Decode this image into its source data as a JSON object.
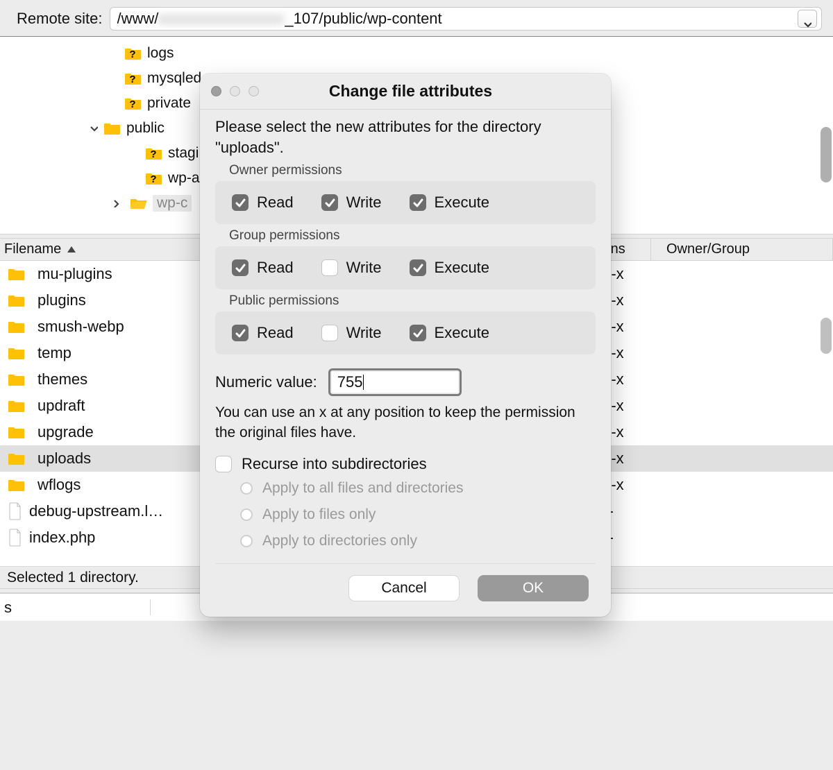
{
  "addr": {
    "label": "Remote site:",
    "prefix": "/www/",
    "suffix": "_107/public/wp-content"
  },
  "tree": {
    "items": [
      {
        "name": "logs"
      },
      {
        "name": "mysqled"
      },
      {
        "name": "private"
      },
      {
        "name": "public"
      },
      {
        "name": "stagi"
      },
      {
        "name": "wp-a"
      },
      {
        "name": "wp-c"
      }
    ]
  },
  "list_header": {
    "filename": "Filename",
    "permissions_partial": "ions",
    "owner_group": "Owner/Group"
  },
  "files": [
    {
      "name": "mu-plugins",
      "type": "folder",
      "perm": "xr-x"
    },
    {
      "name": "plugins",
      "type": "folder",
      "perm": "xr-x"
    },
    {
      "name": "smush-webp",
      "type": "folder",
      "perm": "xr-x"
    },
    {
      "name": "temp",
      "type": "folder",
      "perm": "xr-x"
    },
    {
      "name": "themes",
      "type": "folder",
      "perm": "xr-x"
    },
    {
      "name": "updraft",
      "type": "folder",
      "perm": "xr-x"
    },
    {
      "name": "upgrade",
      "type": "folder",
      "perm": "xr-x"
    },
    {
      "name": "uploads",
      "type": "folder",
      "perm": "xr-x",
      "selected": true
    },
    {
      "name": "wflogs",
      "type": "folder",
      "perm": "xr-x"
    },
    {
      "name": "debug-upstream.l…",
      "type": "file",
      "perm": "r--"
    },
    {
      "name": "index.php",
      "type": "file",
      "perm": "r--"
    }
  ],
  "status": "Selected 1 directory.",
  "bottom_left": "s",
  "modal": {
    "title": "Change file attributes",
    "prompt": "Please select the new attributes for the directory \"uploads\".",
    "sections": {
      "owner": {
        "label": "Owner permissions",
        "read": true,
        "write": true,
        "execute": true
      },
      "group": {
        "label": "Group permissions",
        "read": true,
        "write": false,
        "execute": true
      },
      "public": {
        "label": "Public permissions",
        "read": true,
        "write": false,
        "execute": true
      }
    },
    "perm_labels": {
      "read": "Read",
      "write": "Write",
      "execute": "Execute"
    },
    "numeric_label": "Numeric value:",
    "numeric_value": "755",
    "hint": "You can use an x at any position to keep the permission the original files have.",
    "recurse_label": "Recurse into subdirectories",
    "radio_options": [
      "Apply to all files and directories",
      "Apply to files only",
      "Apply to directories only"
    ],
    "cancel": "Cancel",
    "ok": "OK"
  }
}
